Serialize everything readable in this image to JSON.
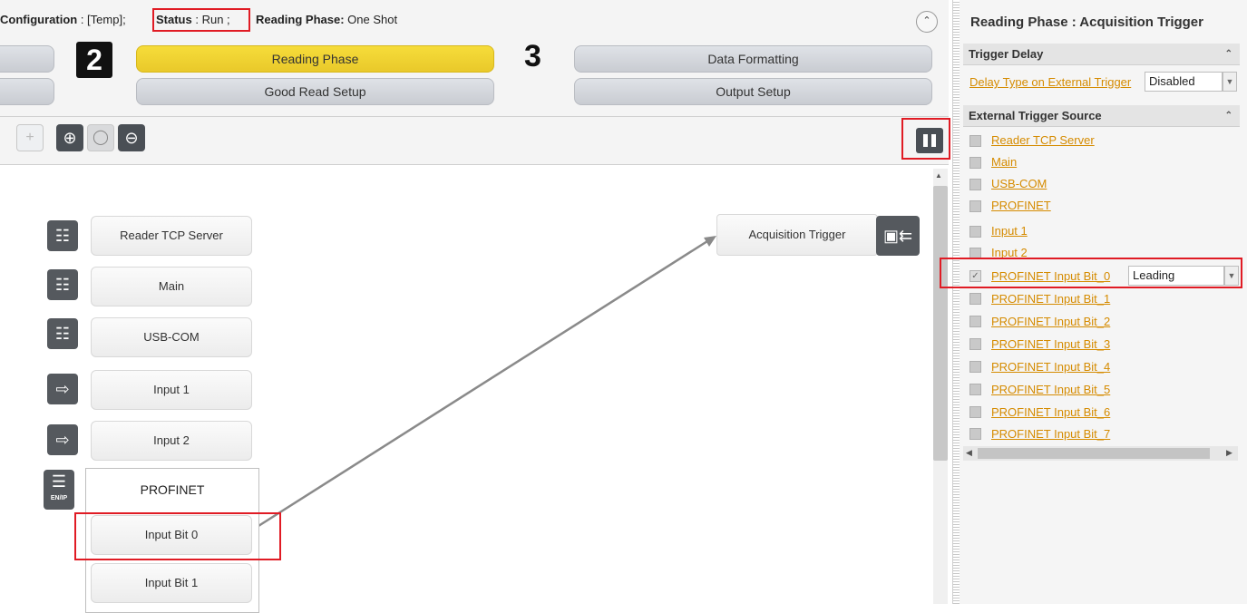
{
  "header": {
    "config_label": "Configuration",
    "config_value": " : [Temp];",
    "status_label": "Status",
    "status_value": " : Run ;",
    "phase_label": "Reading Phase:",
    "phase_value": " One Shot",
    "collapse_icon": "chevron-up-icon"
  },
  "steps": {
    "step2_number": "2",
    "step3_number": "3",
    "reading_phase": "Reading Phase",
    "good_read_setup": "Good Read Setup",
    "data_formatting": "Data Formatting",
    "output_setup": "Output Setup",
    "active_color": "#f0d232"
  },
  "toolbar": {
    "icons": [
      "add-icon",
      "zoom-in-icon",
      "zoom-100-icon",
      "zoom-out-icon"
    ],
    "pause_icon": "pause-icon"
  },
  "canvas": {
    "sources": [
      {
        "label": "Reader TCP Server",
        "icon": "ethernet-icon"
      },
      {
        "label": "Main",
        "icon": "ethernet-icon"
      },
      {
        "label": "USB-COM",
        "icon": "ethernet-icon"
      },
      {
        "label": "Input 1",
        "icon": "input-icon"
      },
      {
        "label": "Input 2",
        "icon": "input-icon"
      }
    ],
    "profinet": {
      "label": "PROFINET",
      "icon_text": "EN/IP",
      "bits": [
        "Input Bit 0",
        "Input Bit 1"
      ]
    },
    "target": {
      "label": "Acquisition Trigger",
      "icon": "camera-trigger-icon"
    }
  },
  "right_panel": {
    "title": "Reading Phase : Acquisition Trigger",
    "trigger_delay": {
      "header": "Trigger Delay",
      "field_label": "Delay Type on External Trigger",
      "field_value": "Disabled"
    },
    "external_source": {
      "header": "External Trigger Source",
      "items": [
        {
          "label": "Reader TCP Server",
          "checked": false
        },
        {
          "label": "Main",
          "checked": false
        },
        {
          "label": "USB-COM",
          "checked": false
        },
        {
          "label": "PROFINET",
          "checked": false
        },
        {
          "label": "Input 1",
          "checked": false
        },
        {
          "label": "Input 2",
          "checked": false
        },
        {
          "label": "PROFINET Input Bit_0",
          "checked": true,
          "edge": "Leading"
        },
        {
          "label": "PROFINET Input Bit_1",
          "checked": false
        },
        {
          "label": "PROFINET Input Bit_2",
          "checked": false
        },
        {
          "label": "PROFINET Input Bit_3",
          "checked": false
        },
        {
          "label": "PROFINET Input Bit_4",
          "checked": false
        },
        {
          "label": "PROFINET Input Bit_5",
          "checked": false
        },
        {
          "label": "PROFINET Input Bit_6",
          "checked": false
        },
        {
          "label": "PROFINET Input Bit_7",
          "checked": false
        }
      ]
    },
    "link_color": "#d58b00"
  },
  "highlight_color": "#e01b24"
}
